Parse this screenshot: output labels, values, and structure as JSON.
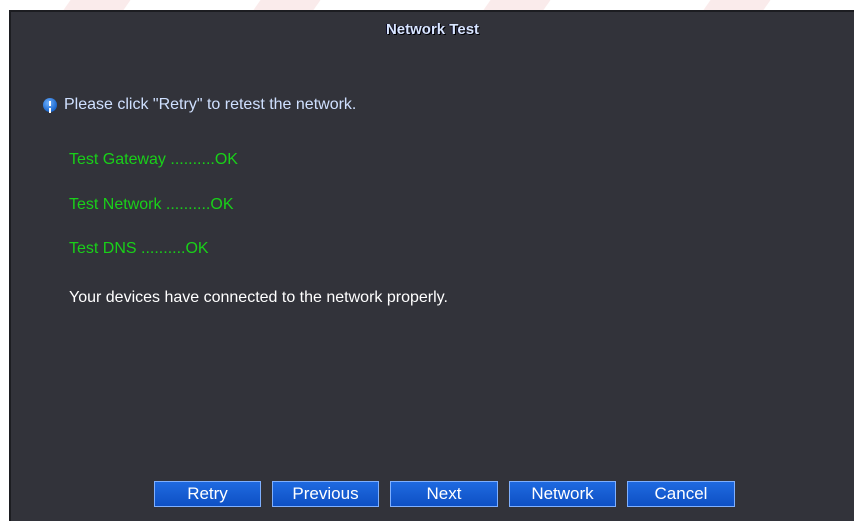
{
  "dialog": {
    "title": "Network Test",
    "hint": "Please click \"Retry\" to retest the network.",
    "tests": [
      "Test Gateway ..........OK",
      "Test Network ..........OK",
      "Test DNS ..........OK"
    ],
    "result": "Your devices have connected to the network properly."
  },
  "buttons": {
    "retry": "Retry",
    "previous": "Previous",
    "next": "Next",
    "network": "Network",
    "cancel": "Cancel"
  },
  "colors": {
    "dialog_bg": "#32333a",
    "test_ok": "#19d019",
    "button_bg": "#1f6ae0",
    "title_text": "#d9e6ff"
  },
  "icons": {
    "hint_icon": "info-icon"
  }
}
